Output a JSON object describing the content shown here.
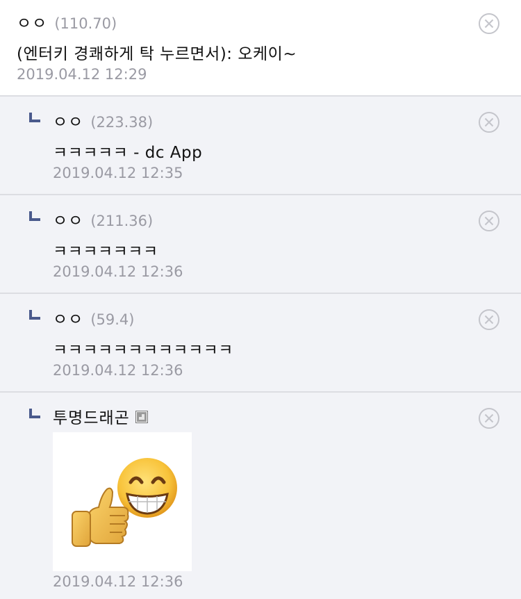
{
  "comments": [
    {
      "nick": "ㅇㅇ",
      "ip": "(110.70)",
      "text": "(엔터키 경쾌하게 탁 누르면서): 오케이~",
      "date": "2019.04.12 12:29"
    },
    {
      "nick": "ㅇㅇ",
      "ip": "(223.38)",
      "text": "ㅋㅋㅋㅋㅋ - dc App",
      "date": "2019.04.12 12:35"
    },
    {
      "nick": "ㅇㅇ",
      "ip": "(211.36)",
      "text": "ㅋㅋㅋㅋㅋㅋㅋ",
      "date": "2019.04.12 12:36"
    },
    {
      "nick": "ㅇㅇ",
      "ip": "(59.4)",
      "text": "ㅋㅋㅋㅋㅋㅋㅋㅋㅋㅋㅋㅋ",
      "date": "2019.04.12 12:36"
    },
    {
      "nick": "투명드래곤",
      "badge_icon": "gallery-member-icon",
      "dccon": "thumbs-up-grin-emoji",
      "date": "2019.04.12 12:36"
    }
  ],
  "icons": {
    "reply": "reply-arrow-icon",
    "delete": "delete-circle-x-icon"
  },
  "colors": {
    "reply_bg": "#f2f3f7",
    "divider": "#dcdde2",
    "meta_text": "#9a9aa3",
    "reply_marker": "#4a5a8c"
  }
}
